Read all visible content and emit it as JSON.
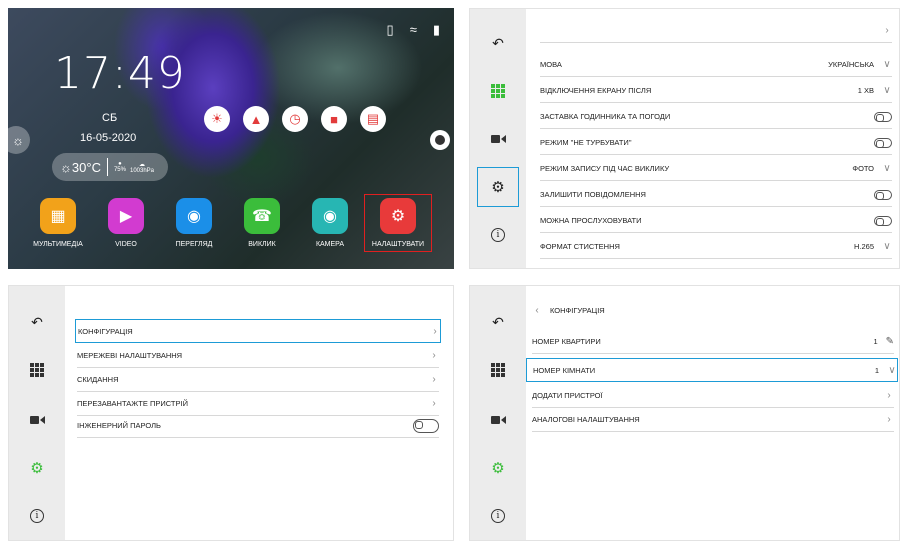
{
  "home": {
    "time": "17:49",
    "day": "СБ",
    "date": "16-05-2020",
    "weather": {
      "temp": "30°C",
      "humidity": "75%",
      "pressure": "1003hPa"
    },
    "apps": [
      {
        "label": "МУЛЬТИМЕДІА",
        "color": "#f2a21a",
        "icon": "grid-icon"
      },
      {
        "label": "VIDEO",
        "color": "#d23bd0",
        "icon": "video-icon"
      },
      {
        "label": "ПЕРЕГЛЯД",
        "color": "#1b8fe8",
        "icon": "eye-icon"
      },
      {
        "label": "ВИКЛИК",
        "color": "#3bbd3b",
        "icon": "phone-icon"
      },
      {
        "label": "КАМЕРА",
        "color": "#27b6b3",
        "icon": "camera-icon"
      },
      {
        "label": "НАЛАШТУВАТИ",
        "color": "#e83a3a",
        "icon": "gear-icon"
      }
    ]
  },
  "set1": {
    "rows": [
      {
        "label": "МОВА",
        "value": "УКРАЇНСЬКА"
      },
      {
        "label": "ВІДКЛЮЧЕННЯ ЕКРАНУ ПІСЛЯ",
        "value": "1 ХВ"
      },
      {
        "label": "ЗАСТАВКА ГОДИННИКА ТА ПОГОДИ"
      },
      {
        "label": "РЕЖИМ \"НЕ ТУРБУВАТИ\""
      },
      {
        "label": "РЕЖИМ ЗАПИСУ ПІД ЧАС ВИКЛИКУ",
        "value": "ФОТО"
      },
      {
        "label": "ЗАЛИШИТИ ПОВІДОМЛЕННЯ"
      },
      {
        "label": "МОЖНА ПРОСЛУХОВУВАТИ"
      },
      {
        "label": "ФОРМАТ СТИСТЕННЯ",
        "value": "H.265"
      }
    ]
  },
  "set2": {
    "rows": [
      {
        "label": "КОНФІГУРАЦІЯ"
      },
      {
        "label": "МЕРЕЖЕВІ НАЛАШТУВАННЯ"
      },
      {
        "label": "СКИДАННЯ"
      },
      {
        "label": "ПЕРЕЗАВАНТАЖТЕ ПРИСТРІЙ"
      },
      {
        "label": "ІНЖЕНЕРНИЙ ПАРОЛЬ"
      }
    ]
  },
  "set3": {
    "title": "КОНФІГУРАЦІЯ",
    "rows": [
      {
        "label": "НОМЕР КВАРТИРИ",
        "value": "1"
      },
      {
        "label": "НОМЕР КІМНАТИ",
        "value": "1"
      },
      {
        "label": "ДОДАТИ ПРИСТРОЇ"
      },
      {
        "label": "АНАЛОГОВІ НАЛАШТУВАННЯ"
      }
    ]
  }
}
